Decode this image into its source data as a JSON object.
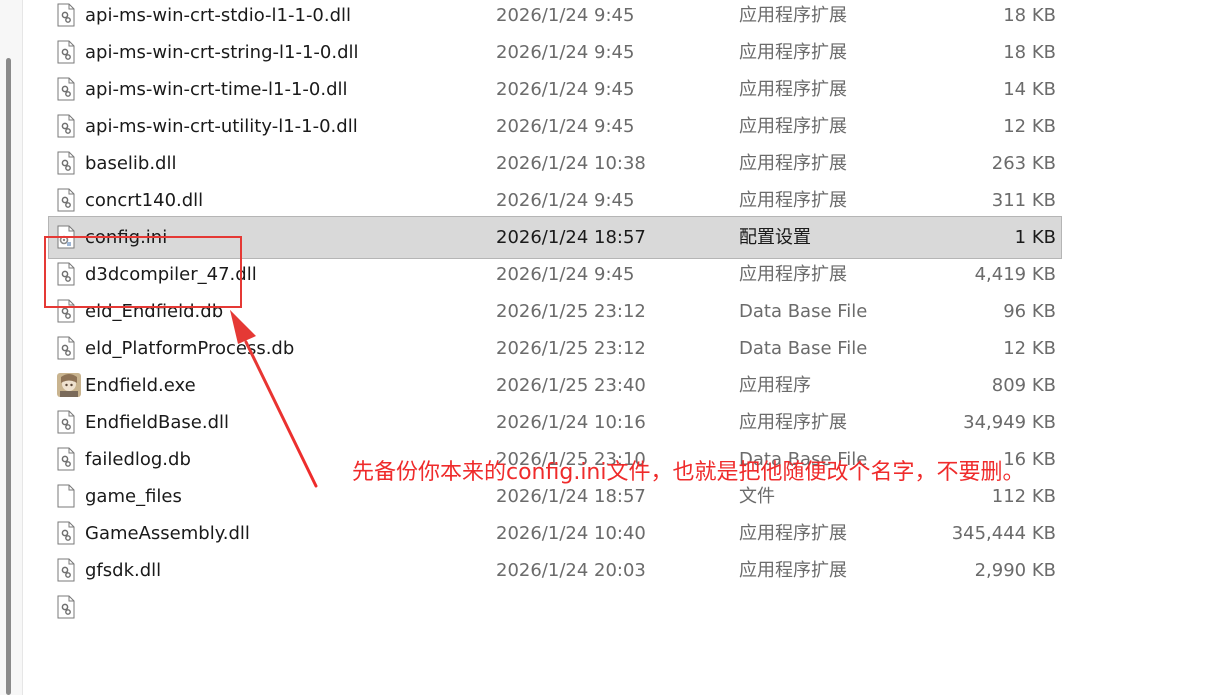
{
  "files": [
    {
      "name": "api-ms-win-crt-stdio-l1-1-0.dll",
      "date": "2026/1/24 9:45",
      "type": "应用程序扩展",
      "size": "18 KB",
      "icon": "dll-icon"
    },
    {
      "name": "api-ms-win-crt-string-l1-1-0.dll",
      "date": "2026/1/24 9:45",
      "type": "应用程序扩展",
      "size": "18 KB",
      "icon": "dll-icon"
    },
    {
      "name": "api-ms-win-crt-time-l1-1-0.dll",
      "date": "2026/1/24 9:45",
      "type": "应用程序扩展",
      "size": "14 KB",
      "icon": "dll-icon"
    },
    {
      "name": "api-ms-win-crt-utility-l1-1-0.dll",
      "date": "2026/1/24 9:45",
      "type": "应用程序扩展",
      "size": "12 KB",
      "icon": "dll-icon"
    },
    {
      "name": "baselib.dll",
      "date": "2026/1/24 10:38",
      "type": "应用程序扩展",
      "size": "263 KB",
      "icon": "dll-icon"
    },
    {
      "name": "concrt140.dll",
      "date": "2026/1/24 9:45",
      "type": "应用程序扩展",
      "size": "311 KB",
      "icon": "dll-icon"
    },
    {
      "name": "config.ini",
      "date": "2026/1/24 18:57",
      "type": "配置设置",
      "size": "1 KB",
      "icon": "ini-icon",
      "selected": true
    },
    {
      "name": "d3dcompiler_47.dll",
      "date": "2026/1/24 9:45",
      "type": "应用程序扩展",
      "size": "4,419 KB",
      "icon": "dll-icon"
    },
    {
      "name": "eld_Endfield.db",
      "date": "2026/1/25 23:12",
      "type": "Data Base File",
      "size": "96 KB",
      "icon": "dll-icon"
    },
    {
      "name": "eld_PlatformProcess.db",
      "date": "2026/1/25 23:12",
      "type": "Data Base File",
      "size": "12 KB",
      "icon": "dll-icon"
    },
    {
      "name": "Endfield.exe",
      "date": "2026/1/25 23:40",
      "type": "应用程序",
      "size": "809 KB",
      "icon": "app-icon"
    },
    {
      "name": "EndfieldBase.dll",
      "date": "2026/1/24 10:16",
      "type": "应用程序扩展",
      "size": "34,949 KB",
      "icon": "dll-icon"
    },
    {
      "name": "failedlog.db",
      "date": "2026/1/25 23:10",
      "type": "Data Base File",
      "size": "16 KB",
      "icon": "dll-icon"
    },
    {
      "name": "game_files",
      "date": "2026/1/24 18:57",
      "type": "文件",
      "size": "112 KB",
      "icon": "blank-file-icon"
    },
    {
      "name": "GameAssembly.dll",
      "date": "2026/1/24 10:40",
      "type": "应用程序扩展",
      "size": "345,444 KB",
      "icon": "dll-icon"
    },
    {
      "name": "gfsdk.dll",
      "date": "2026/1/24 20:03",
      "type": "应用程序扩展",
      "size": "2,990 KB",
      "icon": "dll-icon"
    },
    {
      "name": "",
      "date": "",
      "type": "",
      "size": "",
      "icon": "dll-icon"
    }
  ],
  "annotation": {
    "note": "先备份你本来的config.ini文件，也就是把他随便改个名字，不要删。",
    "color": "#ef2b2b"
  }
}
